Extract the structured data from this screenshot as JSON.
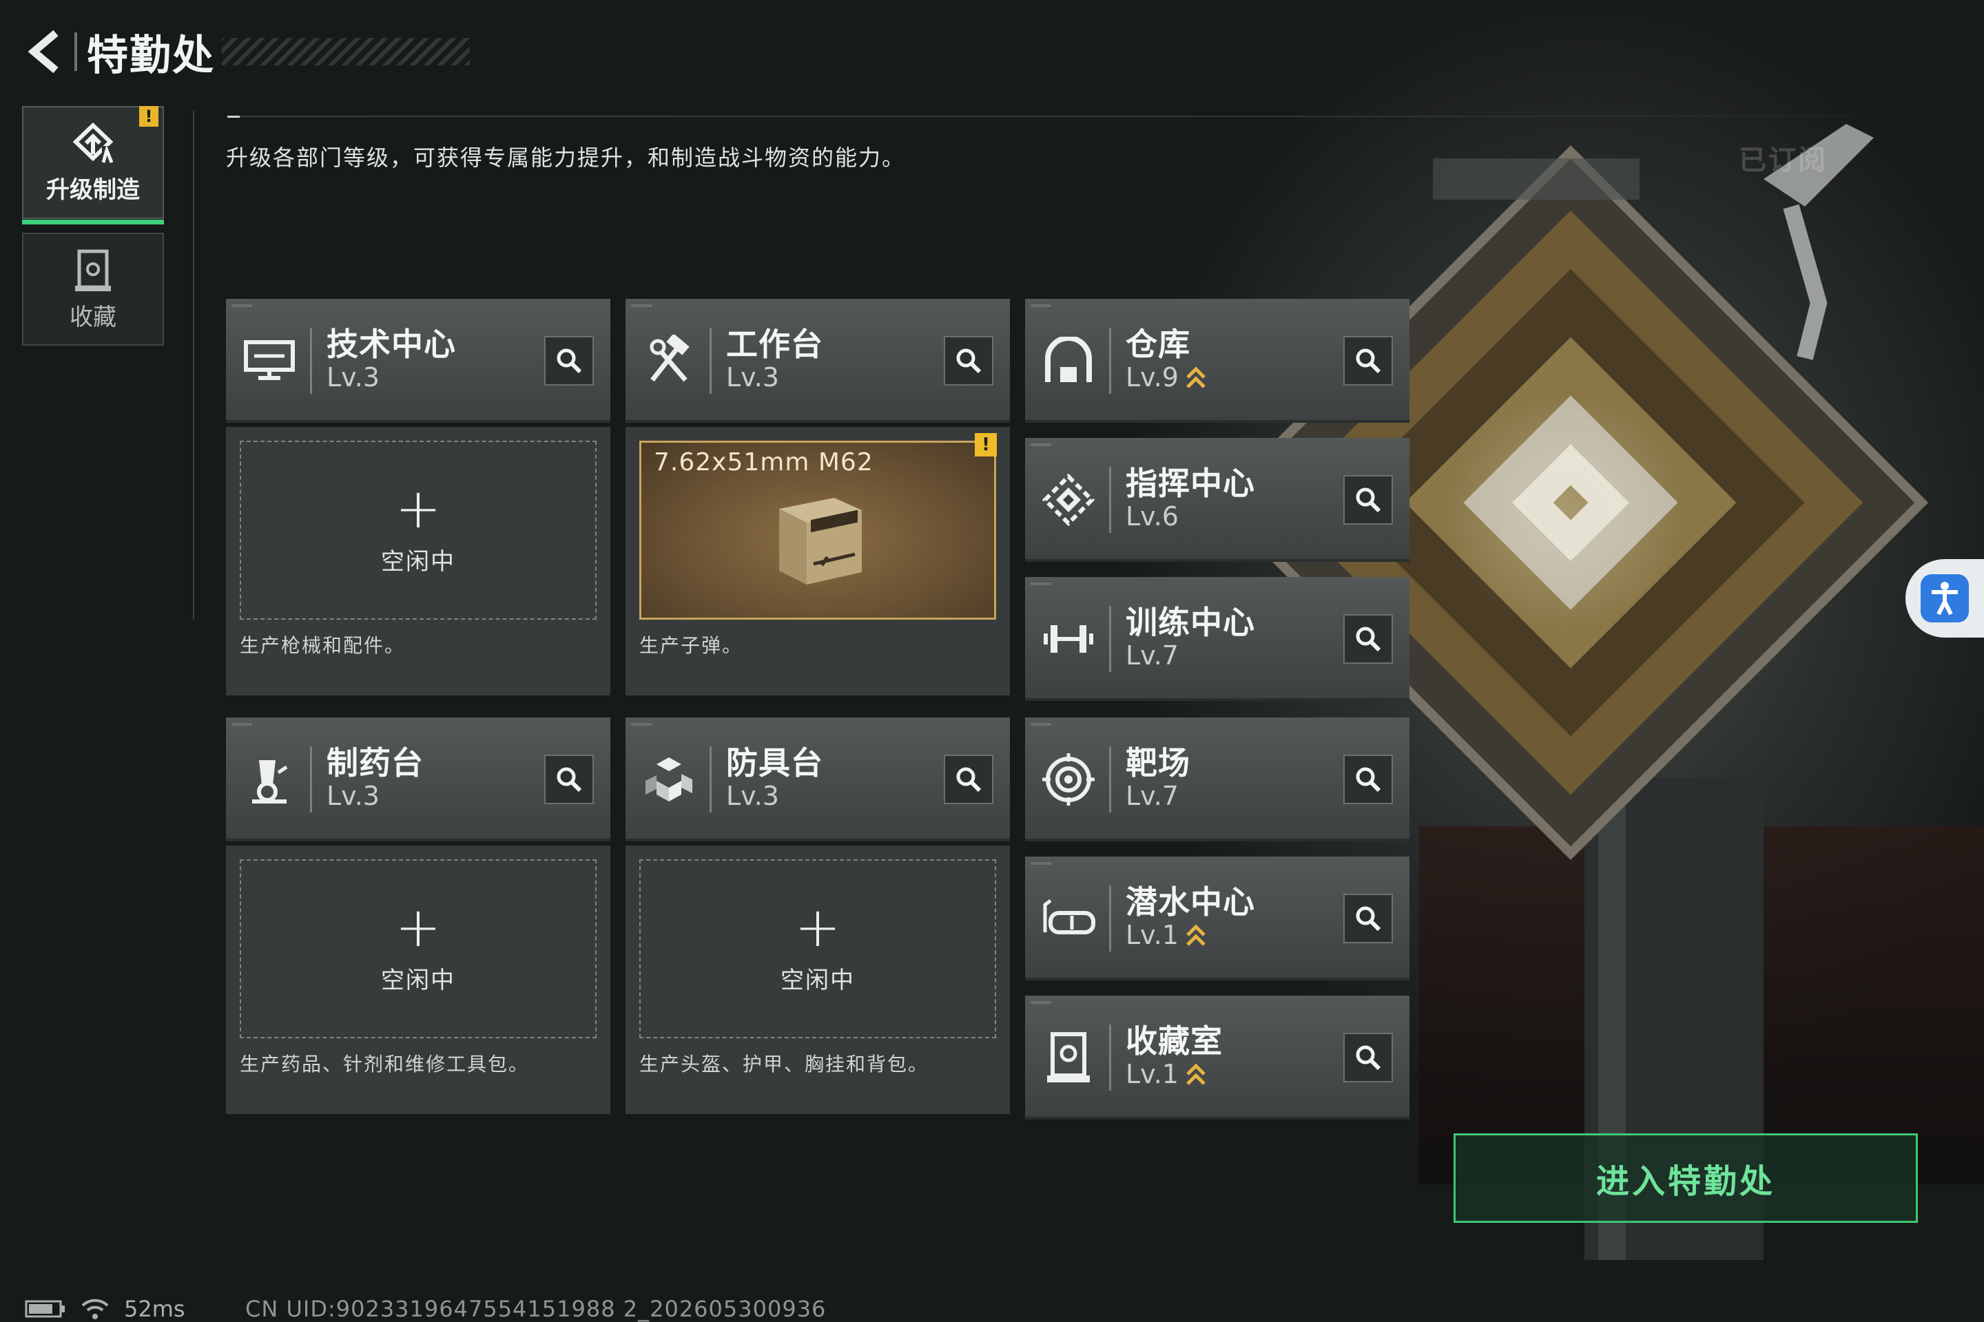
{
  "header": {
    "title": "特勤处"
  },
  "side_nav": [
    {
      "label": "升级制造",
      "active": true,
      "warning": "!"
    },
    {
      "label": "收藏",
      "active": false
    }
  ],
  "description": "升级各部门等级，可获得专属能力提升，和制造战斗物资的能力。",
  "subscribed_label": "已订阅",
  "departments": [
    {
      "name": "技术中心",
      "level": "Lv.3",
      "icon": "monitor-icon",
      "upgrade_available": false
    },
    {
      "name": "工作台",
      "level": "Lv.3",
      "icon": "hammer-wrench-icon",
      "upgrade_available": false
    },
    {
      "name": "仓库",
      "level": "Lv.9",
      "icon": "warehouse-icon",
      "upgrade_available": true
    },
    {
      "name": "指挥中心",
      "level": "Lv.6",
      "icon": "command-icon",
      "upgrade_available": false
    },
    {
      "name": "训练中心",
      "level": "Lv.7",
      "icon": "dumbbell-icon",
      "upgrade_available": false
    },
    {
      "name": "制药台",
      "level": "Lv.3",
      "icon": "microscope-icon",
      "upgrade_available": false
    },
    {
      "name": "防具台",
      "level": "Lv.3",
      "icon": "armor-blocks-icon",
      "upgrade_available": false
    },
    {
      "name": "靶场",
      "level": "Lv.7",
      "icon": "target-icon",
      "upgrade_available": false
    },
    {
      "name": "潜水中心",
      "level": "Lv.1",
      "icon": "diving-mask-icon",
      "upgrade_available": true
    },
    {
      "name": "收藏室",
      "level": "Lv.1",
      "icon": "collection-icon",
      "upgrade_available": true
    }
  ],
  "production": [
    {
      "status": "空闲中",
      "description": "生产枪械和配件。"
    },
    {
      "item": "7.62x51mm M62",
      "warning": "!",
      "description": "生产子弹。"
    },
    {
      "status": "空闲中",
      "description": "生产药品、针剂和维修工具包。"
    },
    {
      "status": "空闲中",
      "description": "生产头盔、护甲、胸挂和背包。"
    }
  ],
  "enter_button": "进入特勤处",
  "status_bar": {
    "ping": "52ms",
    "uid": "CN UID:9023319647554151988 2_202605300936"
  },
  "colors": {
    "accent_green": "#3fc774",
    "warning_yellow": "#e9b52a",
    "upgrade_gold": "#e7b441",
    "card_bg": "#4a4e4e"
  }
}
